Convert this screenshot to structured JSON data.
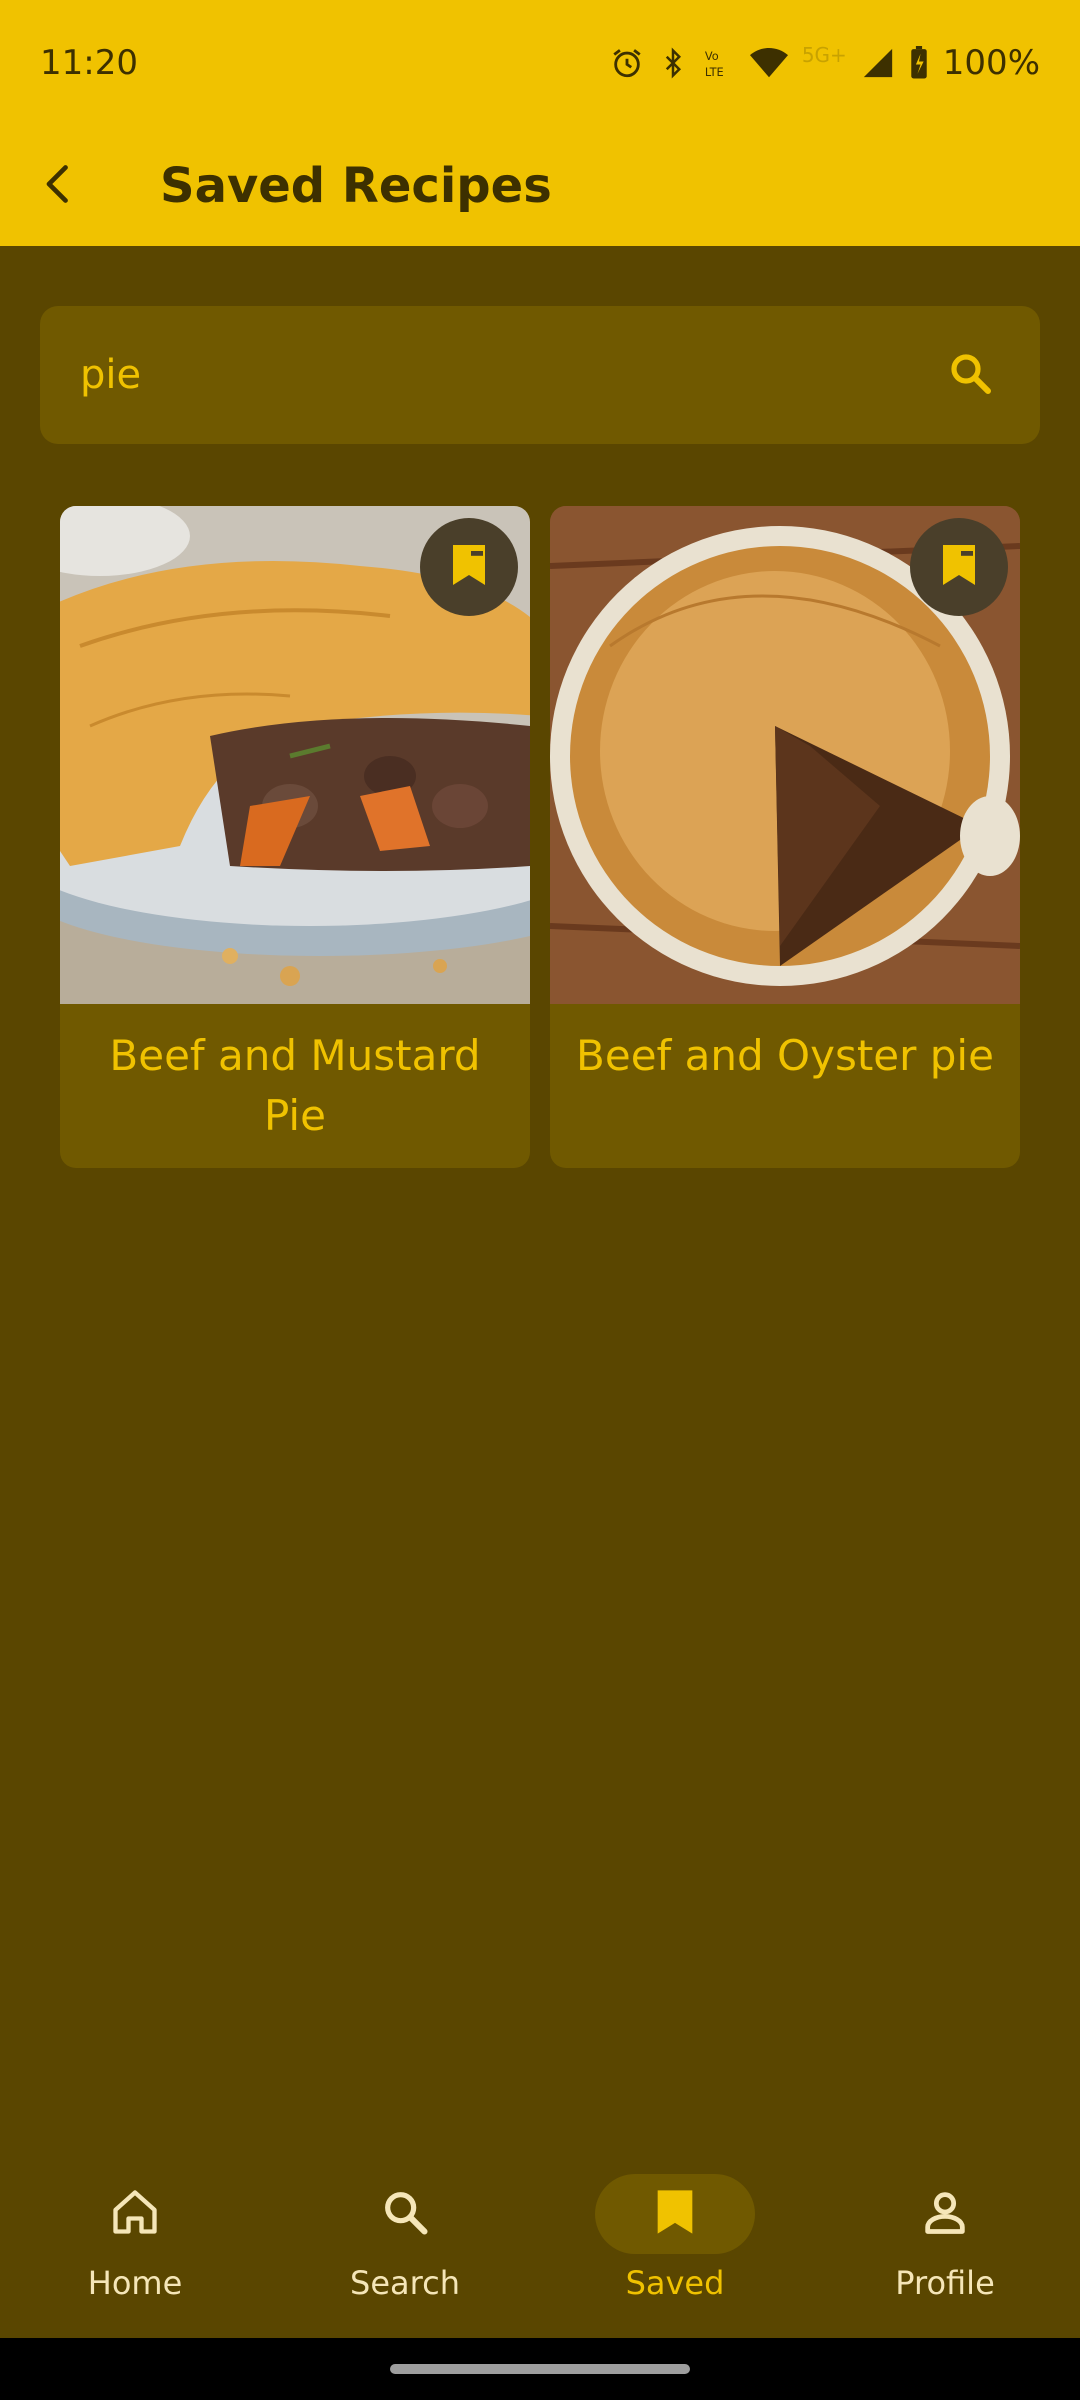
{
  "status_bar": {
    "time": "11:20",
    "network": "5G+",
    "battery": "100%"
  },
  "app_bar": {
    "title": "Saved Recipes"
  },
  "search": {
    "value": "pie"
  },
  "recipes": [
    {
      "title": "Beef and Mustard Pie",
      "bookmarked": true
    },
    {
      "title": "Beef and Oyster pie",
      "bookmarked": true
    }
  ],
  "bottom_nav": {
    "items": [
      {
        "label": "Home",
        "icon": "home-icon",
        "active": false
      },
      {
        "label": "Search",
        "icon": "search-icon",
        "active": false
      },
      {
        "label": "Saved",
        "icon": "bookmark-icon",
        "active": true
      },
      {
        "label": "Profile",
        "icon": "person-icon",
        "active": false
      }
    ]
  },
  "colors": {
    "accent": "#f0c200",
    "background": "#5a4600",
    "surface": "#705900"
  }
}
